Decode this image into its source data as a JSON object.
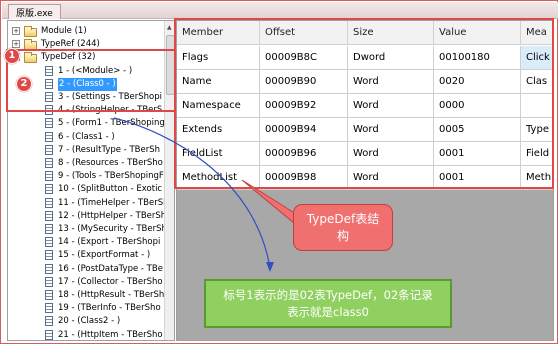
{
  "window": {
    "tab_title": "原版.exe"
  },
  "tree": {
    "top_nodes": [
      {
        "label": "Module (1)",
        "expander": "+"
      },
      {
        "label": "TypeRef (244)",
        "expander": "+"
      },
      {
        "label": "TypeDef (32)",
        "expander": "-"
      }
    ],
    "children": [
      "1 - (<Module> - )",
      "2 - (Class0 - )",
      "3 - (Settings - TBerShopi",
      "4 - (StringHelper - TBerS",
      "5 - (Form1 - TBerShoping",
      "6 - (Class1 - )",
      "7 - (ResultType - TBerSh",
      "8 - (Resources - TBerSho",
      "9 - (Tools - TBerShopingF",
      "10 - (SplitButton - Exotic",
      "11 - (TimeHelper - TBerSh",
      "12 - (HttpHelper - TBerSh",
      "13 - (MySecurity - TBerSh",
      "14 - (Export - TBerShopi",
      "15 - (ExportFormat - )",
      "16 - (PostDataType - TBe",
      "17 - (Collector - TBerSho",
      "18 - (HttpResult - TBerSh",
      "19 - (TBerInfo - TBerSho",
      "20 - (Class2 - )",
      "21 - (HttpItem - TBerSho"
    ],
    "selected_index": 1
  },
  "grid": {
    "columns": [
      "Member",
      "Offset",
      "Size",
      "Value",
      "Mea"
    ],
    "rows": [
      [
        "Flags",
        "00009B8C",
        "Dword",
        "00100180",
        "Click"
      ],
      [
        "Name",
        "00009B90",
        "Word",
        "0020",
        "Clas"
      ],
      [
        "Namespace",
        "00009B92",
        "Word",
        "0000",
        ""
      ],
      [
        "Extends",
        "00009B94",
        "Word",
        "0005",
        "Type"
      ],
      [
        "FieldList",
        "00009B96",
        "Word",
        "0001",
        "Field"
      ],
      [
        "MethodList",
        "00009B98",
        "Word",
        "0001",
        "Meth"
      ]
    ]
  },
  "annotations": {
    "badge1": "1",
    "badge2": "2",
    "callout_typedef_line1": "TypeDef表结",
    "callout_typedef_line2": "构",
    "callout_note_line1": "标号1表示的是02表TypeDef，02条记录",
    "callout_note_line2": "表示就是class0",
    "colors": {
      "highlight": "#e04848",
      "note_fill": "#90d060",
      "callout_fill": "#f07070",
      "arrow": "#3050c0"
    }
  }
}
